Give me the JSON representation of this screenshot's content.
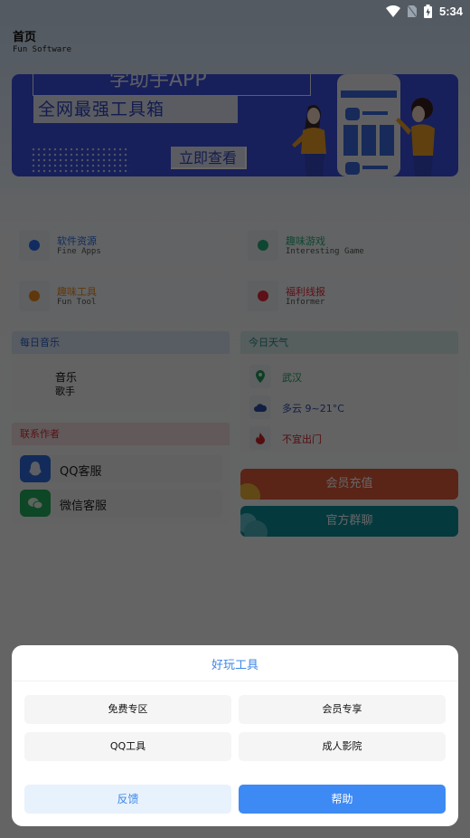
{
  "status_bar": {
    "time": "5:34",
    "icons": [
      "wifi-icon",
      "no-sim-icon",
      "battery-charging-icon"
    ]
  },
  "header": {
    "title": "首页",
    "subtitle": "Fun Software"
  },
  "banner": {
    "cut_title": "学助手APP",
    "slogan": "全网最强工具箱",
    "cta": "立即查看"
  },
  "categories": [
    {
      "title": "软件资源",
      "subtitle": "Fine Apps",
      "color": "#2a6ef0"
    },
    {
      "title": "趣味游戏",
      "subtitle": "Interesting Game",
      "color": "#25b07a"
    },
    {
      "title": "趣味工具",
      "subtitle": "Fun Tool",
      "color": "#f08a1c"
    },
    {
      "title": "福利线报",
      "subtitle": "Informer",
      "color": "#e8283a"
    }
  ],
  "music": {
    "header": "每日音乐",
    "title": "音乐",
    "artist": "歌手",
    "accent": "#2c62c8"
  },
  "weather": {
    "header": "今日天气",
    "accent": "#2a8b8a",
    "rows": [
      {
        "icon": "location-pin-icon",
        "text": "武汉",
        "color": "#1f9e5a"
      },
      {
        "icon": "cloud-icon",
        "text": "多云 9~21°C",
        "color": "#2c4fa8"
      },
      {
        "icon": "fire-icon",
        "text": "不宜出门",
        "color": "#d2252a"
      }
    ]
  },
  "contact": {
    "header": "联系作者",
    "accent": "#d9333f",
    "rows": [
      {
        "icon": "qq-icon",
        "text": "QQ客服",
        "color": "#2e6ce0"
      },
      {
        "icon": "wechat-icon",
        "text": "微信客服",
        "color": "#21b15c"
      }
    ]
  },
  "actions": [
    {
      "label": "会员充值",
      "color": "#e25a3a"
    },
    {
      "label": "官方群聊",
      "color": "#0b8f9c"
    }
  ],
  "dialog": {
    "title": "好玩工具",
    "options": [
      "免费专区",
      "会员专享",
      "QQ工具",
      "成人影院"
    ],
    "cancel": "反馈",
    "confirm": "帮助",
    "confirm_color": "#3e8af4",
    "cancel_bg": "#e8f2fd"
  }
}
